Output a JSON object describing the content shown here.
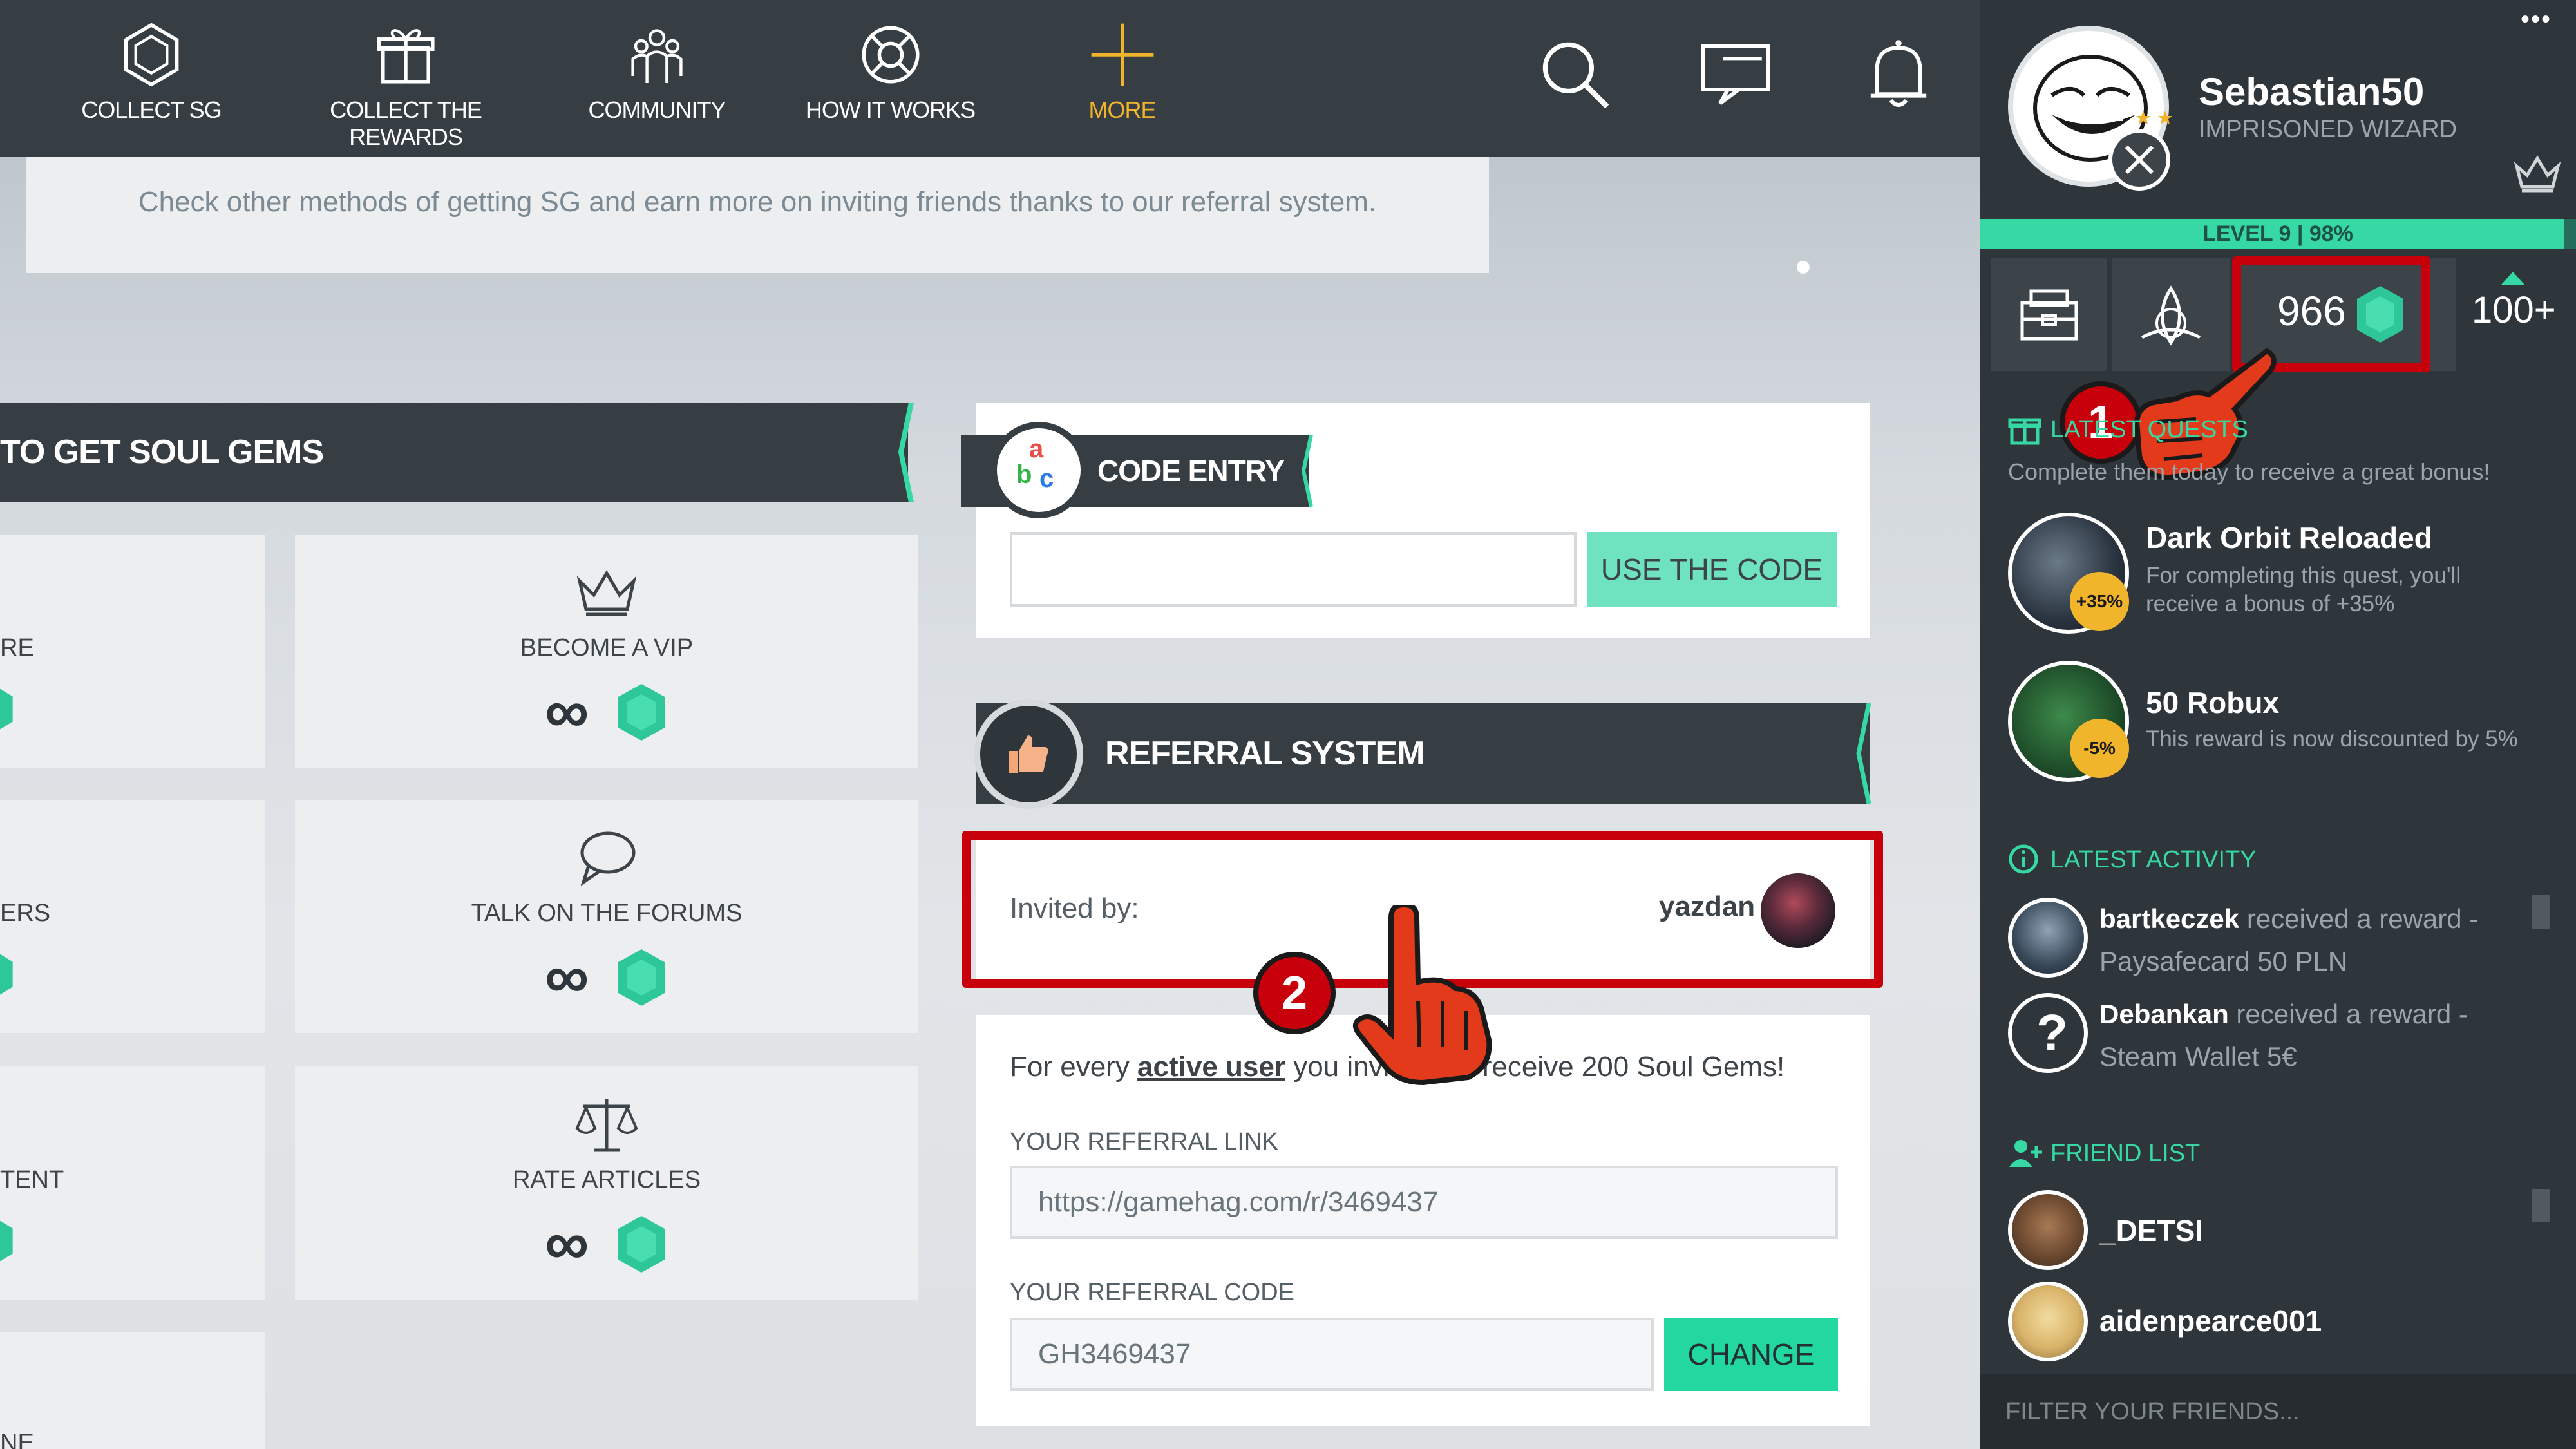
{
  "nav": {
    "items": [
      {
        "label": "COLLECT SG",
        "icon": "hexagon-icon"
      },
      {
        "label": "COLLECT THE REWARDS",
        "icon": "gift-icon"
      },
      {
        "label": "COMMUNITY",
        "icon": "community-icon"
      },
      {
        "label": "HOW IT WORKS",
        "icon": "lifebuoy-icon"
      },
      {
        "label": "MORE",
        "icon": "plus-icon"
      }
    ],
    "accent": "#f0b52b"
  },
  "info_text": "Check other methods of getting SG and earn more on inviting friends thanks to our referral system.",
  "ways": {
    "heading": "TO GET SOUL GEMS",
    "left_partial": [
      "RE",
      "ERS",
      "TENT",
      "NE"
    ],
    "tiles": [
      {
        "label": "BECOME A VIP",
        "icon": "crown-icon",
        "value": "∞"
      },
      {
        "label": "TALK ON THE FORUMS",
        "icon": "chat-bubble-icon",
        "value": "∞"
      },
      {
        "label": "RATE ARTICLES",
        "icon": "scales-icon",
        "value": "∞"
      }
    ]
  },
  "code_entry": {
    "title": "CODE ENTRY",
    "input_value": "",
    "button": "USE THE CODE"
  },
  "referral": {
    "title": "REFERRAL SYSTEM",
    "invited_by_label": "Invited by:",
    "invited_by_name": "yazdan",
    "description_pre": "For every ",
    "description_link": "active user",
    "description_post": " you invite, you receive 200 Soul Gems!",
    "link_label": "YOUR REFERRAL LINK",
    "link_value": "https://gamehag.com/r/3469437",
    "code_label": "YOUR REFERRAL CODE",
    "code_value": "GH3469437",
    "change_button": "CHANGE"
  },
  "annotations": {
    "step1": "1",
    "step2": "2"
  },
  "sidebar": {
    "menu_dots": "•••",
    "username": "Sebastian50",
    "rank": "IMPRISONED WIZARD",
    "level_text": "LEVEL 9 | 98%",
    "level_progress": 0.98,
    "gems": "966",
    "notif_count": "100+",
    "quests_heading": "LATEST QUESTS",
    "quests_sub": "Complete them today to receive a great bonus!",
    "quests": [
      {
        "title": "Dark Orbit Reloaded",
        "desc": "For completing this quest, you'll receive a bonus of +35%",
        "badge": "+35%"
      },
      {
        "title": "50 Robux",
        "desc": "This reward is now discounted by 5%",
        "badge": "-5%"
      }
    ],
    "activity_heading": "LATEST ACTIVITY",
    "activity": [
      {
        "user": "bartkeczek",
        "action": "received a reward -",
        "reward": "Paysafecard 50 PLN"
      },
      {
        "user": "Debankan",
        "action": "received a reward -",
        "reward": "Steam Wallet 5€"
      }
    ],
    "friends_heading": "FRIEND LIST",
    "friends": [
      "_DETSI",
      "aidenpearce001"
    ],
    "filter_placeholder": "FILTER YOUR FRIENDS..."
  },
  "colors": {
    "dark": "#373e43",
    "teal": "#36d9a4",
    "teal_button": "#6fe3bf",
    "gem": "#2ec79a",
    "annotation_red": "#c8000b"
  }
}
